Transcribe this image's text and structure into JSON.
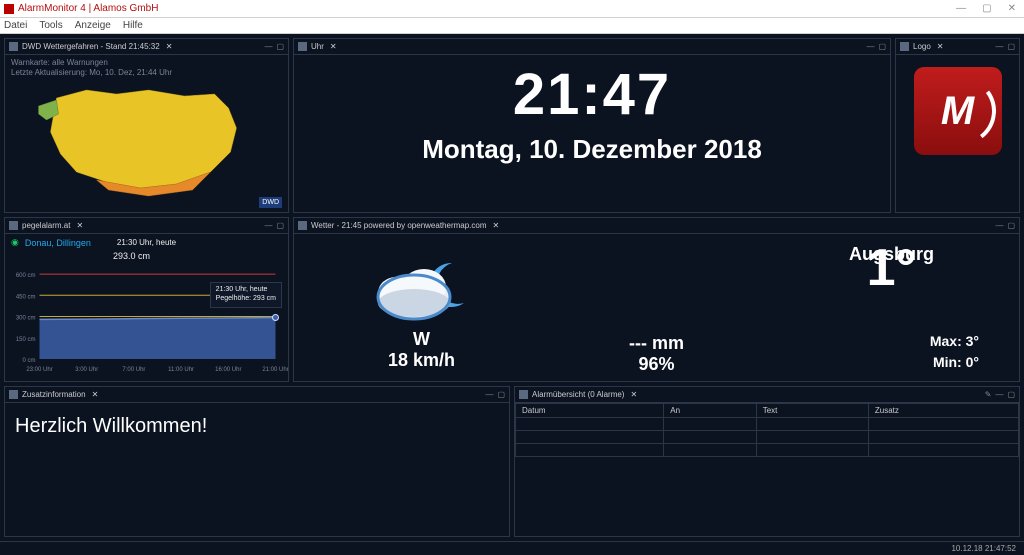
{
  "app": {
    "title": "AlarmMonitor 4 | Alamos GmbH",
    "menu": [
      "Datei",
      "Tools",
      "Anzeige",
      "Hilfe"
    ]
  },
  "panels": {
    "dwd": {
      "title": "DWD Wettergefahren - Stand 21:45:32",
      "heading": "Warnkarte: alle Warnungen",
      "updated": "Letzte Aktualisierung: Mo, 10. Dez, 21:44 Uhr",
      "badge": "DWD"
    },
    "clock": {
      "title": "Uhr",
      "time": "21:47",
      "date": "Montag, 10. Dezember 2018"
    },
    "logo": {
      "title": "Logo"
    },
    "pegel": {
      "title": "pegelalarm.at",
      "location": "Donau, Dillingen",
      "now_label": "21:30 Uhr, heute",
      "value": "293.0 cm",
      "tooltip_line1": "21:30 Uhr, heute",
      "tooltip_line2": "Pegelhöhe: 293 cm"
    },
    "wetter": {
      "title": "Wetter - 21:45 powered by openweathermap.com",
      "location": "Augsburg",
      "temp": "1°",
      "wind_dir": "W",
      "wind_speed": "18 km/h",
      "rain": "--- mm",
      "humidity": "96%",
      "max": "Max: 3°",
      "min": "Min: 0°"
    },
    "zusatz": {
      "title": "Zusatzinformation",
      "text": "Herzlich Willkommen!"
    },
    "alarme": {
      "title": "Alarmübersicht (0 Alarme)",
      "columns": [
        "Datum",
        "An",
        "Text",
        "Zusatz"
      ]
    }
  },
  "status": {
    "right": "10.12.18 21:47:52"
  },
  "chart_data": {
    "type": "line",
    "title": "",
    "xlabel": "",
    "ylabel": "",
    "categories": [
      "23:00 Uhr",
      "3:00 Uhr",
      "7:00 Uhr",
      "11:00 Uhr",
      "16:00 Uhr",
      "21:00 Uhr"
    ],
    "yticks": [
      0,
      150,
      300,
      450,
      600
    ],
    "series": [
      {
        "name": "Pegelhöhe",
        "values": [
          280,
          282,
          285,
          288,
          290,
          293
        ],
        "color": "#3b5fa8"
      }
    ],
    "thresholds": [
      {
        "value": 300,
        "color": "#c8a836"
      },
      {
        "value": 450,
        "color": "#c8a836"
      },
      {
        "value": 600,
        "color": "#cc3b3b"
      }
    ],
    "ylim": [
      0,
      650
    ]
  }
}
